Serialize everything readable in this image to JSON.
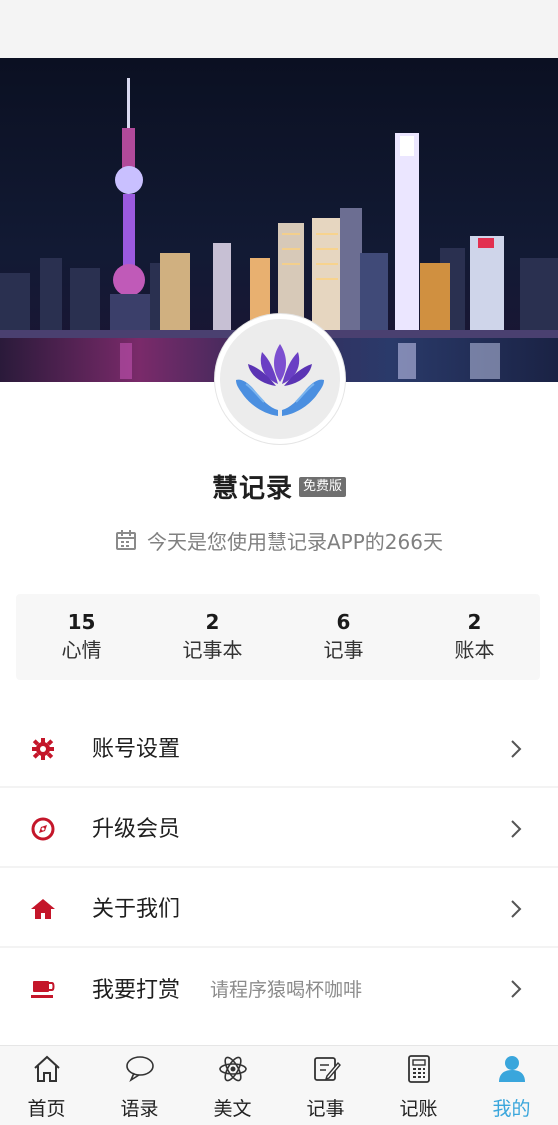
{
  "app": {
    "name": "慧记录",
    "edition_badge": "免费版",
    "usage_text": "今天是您使用慧记录APP的266天"
  },
  "stats": [
    {
      "value": "15",
      "label": "心情"
    },
    {
      "value": "2",
      "label": "记事本"
    },
    {
      "value": "6",
      "label": "记事"
    },
    {
      "value": "2",
      "label": "账本"
    }
  ],
  "menu": [
    {
      "label": "账号设置",
      "sub": "",
      "icon": "gear-icon"
    },
    {
      "label": "升级会员",
      "sub": "",
      "icon": "compass-icon"
    },
    {
      "label": "关于我们",
      "sub": "",
      "icon": "home-icon"
    },
    {
      "label": "我要打赏",
      "sub": "请程序猿喝杯咖啡",
      "icon": "coffee-icon"
    }
  ],
  "tabs": [
    {
      "label": "首页",
      "icon": "home-outline-icon",
      "active": false
    },
    {
      "label": "语录",
      "icon": "chat-bubble-icon",
      "active": false
    },
    {
      "label": "美文",
      "icon": "atom-icon",
      "active": false
    },
    {
      "label": "记事",
      "icon": "note-edit-icon",
      "active": false
    },
    {
      "label": "记账",
      "icon": "calculator-icon",
      "active": false
    },
    {
      "label": "我的",
      "icon": "user-icon",
      "active": true
    }
  ],
  "colors": {
    "menu_icon": "#c4162a",
    "tab_active": "#3aa6dc",
    "tab_inactive": "#333333",
    "badge": "#6f6f6f"
  }
}
